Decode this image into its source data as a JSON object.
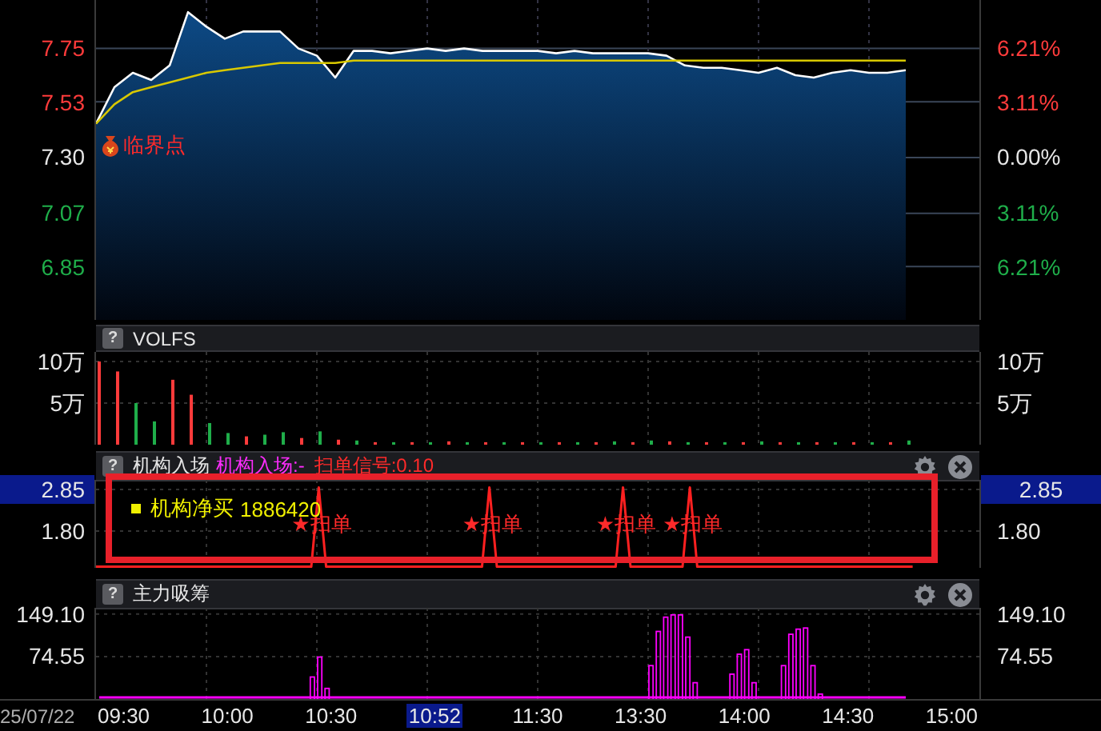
{
  "main_chart": {
    "right_axis": [
      {
        "label": "6.21%",
        "color": "#ff3b3b"
      },
      {
        "label": "3.11%",
        "color": "#ff3b3b"
      },
      {
        "label": "0.00%",
        "color": "#e6e6e6"
      },
      {
        "label": "3.11%",
        "color": "#1fae4a"
      },
      {
        "label": "6.21%",
        "color": "#1fae4a"
      }
    ],
    "marker_label": "临界点",
    "chart_data": {
      "type": "line",
      "categories": [
        null,
        null,
        null,
        null,
        null,
        null,
        null,
        null,
        null,
        null,
        null,
        null,
        null,
        null,
        null,
        null,
        null,
        null,
        null,
        null,
        null,
        null,
        null,
        null,
        null,
        null,
        null,
        null,
        null,
        null,
        null,
        null,
        null,
        null,
        null,
        null,
        null,
        null,
        null,
        null,
        null,
        null,
        null,
        null,
        null,
        null,
        null,
        null,
        null
      ],
      "series": [
        {
          "color": "#ffffff",
          "values": [
            7.44,
            7.59,
            7.65,
            7.62,
            7.68,
            7.9,
            7.84,
            7.79,
            7.82,
            7.82,
            7.82,
            7.75,
            7.72,
            7.63,
            7.74,
            7.74,
            7.73,
            7.74,
            7.75,
            7.74,
            7.75,
            7.74,
            7.74,
            7.74,
            7.74,
            7.73,
            7.74,
            7.73,
            7.73,
            7.73,
            7.73,
            7.72,
            7.68,
            7.67,
            7.67,
            7.66,
            7.65,
            7.67,
            7.64,
            7.63,
            7.65,
            7.66,
            7.65,
            7.65,
            7.66,
            null,
            null,
            null,
            null
          ]
        },
        {
          "color": "#d8c800",
          "values": [
            7.44,
            7.52,
            7.57,
            7.59,
            7.61,
            7.63,
            7.65,
            7.66,
            7.67,
            7.68,
            7.69,
            7.69,
            7.69,
            7.69,
            7.7,
            7.7,
            7.7,
            7.7,
            7.7,
            7.7,
            7.7,
            7.7,
            7.7,
            7.7,
            7.7,
            7.7,
            7.7,
            7.7,
            7.7,
            7.7,
            7.7,
            7.7,
            7.7,
            7.7,
            7.7,
            7.7,
            7.7,
            7.7,
            7.7,
            7.7,
            7.7,
            7.7,
            7.7,
            7.7,
            7.7,
            null,
            null,
            null,
            null
          ]
        }
      ],
      "grid": true,
      "ylim": [
        6.63,
        7.95
      ],
      "yticks": [
        {
          "value": 7.75,
          "label": "7.75"
        },
        {
          "value": 7.53,
          "label": "7.53"
        },
        {
          "value": 7.3,
          "label": "7.30"
        },
        {
          "value": 7.07,
          "label": "7.07"
        },
        {
          "value": 6.85,
          "label": "6.85"
        }
      ]
    }
  },
  "volume_panel": {
    "help_label": "?",
    "controls": false,
    "right_axis": [
      "10万",
      "5万"
    ],
    "chart_data": {
      "type": "bar",
      "title": "VOLFS",
      "categories": [
        null,
        null,
        null,
        null,
        null,
        null,
        null,
        null,
        null,
        null,
        null,
        null,
        null,
        null,
        null,
        null,
        null,
        null,
        null,
        null,
        null,
        null,
        null,
        null,
        null,
        null,
        null,
        null,
        null,
        null,
        null,
        null,
        null,
        null,
        null,
        null,
        null,
        null,
        null,
        null,
        null,
        null,
        null,
        null,
        null,
        null,
        null,
        null
      ],
      "series": [
        {
          "color": "#ff3b3b",
          "values": [
            10,
            8.8,
            null,
            null,
            7.8,
            6,
            null,
            null,
            1,
            null,
            null,
            0.8,
            null,
            0.6,
            null,
            0.3,
            null,
            0.3,
            null,
            0.4,
            null,
            0.3,
            null,
            0.3,
            null,
            0.3,
            null,
            0.3,
            null,
            0.3,
            null,
            0.4,
            null,
            0.3,
            null,
            0.3,
            null,
            0.3,
            null,
            0.3,
            null,
            0.3,
            null,
            0.3,
            null,
            null,
            null,
            null
          ]
        },
        {
          "color": "#1fae4a",
          "values": [
            null,
            null,
            5,
            2.8,
            null,
            null,
            2.6,
            1.4,
            null,
            1.2,
            1.5,
            null,
            1.6,
            null,
            0.5,
            null,
            0.3,
            null,
            0.3,
            null,
            0.3,
            null,
            0.3,
            null,
            0.3,
            null,
            0.3,
            null,
            0.4,
            null,
            0.5,
            null,
            0.3,
            null,
            0.3,
            null,
            0.4,
            null,
            0.3,
            null,
            0.3,
            null,
            0.3,
            null,
            0.5,
            null,
            null,
            null
          ]
        }
      ],
      "grid": true,
      "ylim": [
        0,
        11.15
      ],
      "yticks": [
        {
          "value": 10,
          "label": "10万"
        },
        {
          "value": 5,
          "label": "5万"
        }
      ]
    }
  },
  "signal_panel": {
    "help_label": "?",
    "indicator": "机构入场:-",
    "signal": "扫单信号:0.10",
    "controls": true,
    "left_axis": [
      {
        "selected": true
      },
      {
        "selected": false
      }
    ],
    "right_axis": [
      {
        "label": "2.85",
        "selected": true
      },
      {
        "label": "1.80",
        "selected": false
      }
    ],
    "legend": "机构净买",
    "legend_value": "1886420",
    "sweep_labels": [
      "★扫单",
      "★扫单",
      "★扫单",
      "★扫单"
    ],
    "chart_data": {
      "type": "line",
      "title": "机构入场",
      "categories": [
        null,
        null,
        null,
        null,
        null,
        null,
        null,
        null,
        null,
        null,
        null,
        null,
        null,
        null,
        null,
        null,
        null,
        null,
        null,
        null,
        null,
        null,
        null,
        null,
        null,
        null,
        null,
        null,
        null,
        null,
        null,
        null,
        null,
        null,
        null,
        null,
        null,
        null,
        null,
        null,
        null,
        null,
        null,
        null,
        null,
        null,
        null,
        null,
        null,
        null,
        null,
        null,
        null,
        null,
        null,
        null,
        null,
        null,
        null,
        null,
        null,
        null,
        null,
        null,
        null,
        null,
        null,
        null,
        null,
        null,
        null,
        null,
        null,
        null,
        null,
        null,
        null,
        null,
        null,
        null,
        null,
        null,
        null,
        null,
        null,
        null,
        null,
        null,
        null,
        null,
        null,
        null,
        null,
        null,
        null,
        null,
        null,
        null,
        null,
        null,
        null,
        null,
        null,
        null,
        null,
        null,
        null,
        null,
        null,
        null,
        null,
        null,
        null,
        null,
        null,
        null,
        null,
        null,
        null,
        null
      ],
      "series": [
        {
          "color": "#ff2020",
          "values": [
            0.9,
            0.9,
            0.9,
            0.9,
            0.9,
            0.9,
            0.9,
            0.9,
            0.9,
            0.9,
            0.9,
            0.9,
            0.9,
            0.9,
            0.9,
            0.9,
            0.9,
            0.9,
            0.9,
            0.9,
            0.9,
            0.9,
            0.9,
            0.9,
            0.9,
            0.9,
            0.9,
            0.9,
            0.9,
            0.9,
            2.9,
            0.9,
            0.9,
            0.9,
            0.9,
            0.9,
            0.9,
            0.9,
            0.9,
            0.9,
            0.9,
            0.9,
            0.9,
            0.9,
            0.9,
            0.9,
            0.9,
            0.9,
            0.9,
            0.9,
            0.9,
            0.9,
            0.9,
            2.9,
            0.9,
            0.9,
            0.9,
            0.9,
            0.9,
            0.9,
            0.9,
            0.9,
            0.9,
            0.9,
            0.9,
            0.9,
            0.9,
            0.9,
            0.9,
            0.9,
            0.9,
            2.9,
            0.9,
            0.9,
            0.9,
            0.9,
            0.9,
            0.9,
            0.9,
            0.9,
            2.9,
            0.9,
            0.9,
            0.9,
            0.9,
            0.9,
            0.9,
            0.9,
            0.9,
            0.9,
            0.9,
            0.9,
            0.9,
            0.9,
            0.9,
            0.9,
            0.9,
            0.9,
            0.9,
            0.9,
            0.9,
            0.9,
            0.9,
            0.9,
            0.9,
            0.9,
            0.9,
            0.9,
            0.9,
            0.9,
            0.9,
            null,
            null,
            null,
            null,
            null,
            null,
            null,
            null,
            null
          ]
        }
      ],
      "grid": true,
      "ylim": [
        0.87,
        3.09
      ],
      "yticks": [
        {
          "value": 2.85,
          "label": "2.85"
        },
        {
          "value": 1.8,
          "label": "1.80"
        }
      ]
    }
  },
  "bottom_panel": {
    "help_label": "?",
    "controls": true,
    "right_axis": [
      "149.10",
      "74.55"
    ],
    "chart_data": {
      "type": "bar",
      "title": "主力吸筹",
      "categories": [
        null,
        null,
        null,
        null,
        null,
        null,
        null,
        null,
        null,
        null,
        null,
        null,
        null,
        null,
        null,
        null,
        null,
        null,
        null,
        null,
        null,
        null,
        null,
        null,
        null,
        null,
        null,
        null,
        null,
        null,
        null,
        null,
        null,
        null,
        null,
        null,
        null,
        null,
        null,
        null,
        null,
        null,
        null,
        null,
        null,
        null,
        null,
        null,
        null,
        null,
        null,
        null,
        null,
        null,
        null,
        null,
        null,
        null,
        null,
        null,
        null,
        null,
        null,
        null,
        null,
        null,
        null,
        null,
        null,
        null,
        null,
        null,
        null,
        null,
        null,
        null,
        null,
        null,
        null,
        null,
        null,
        null,
        null,
        null,
        null,
        null,
        null,
        null,
        null,
        null,
        null,
        null,
        null,
        null,
        null,
        null,
        null,
        null,
        null,
        null,
        null,
        null,
        null,
        null,
        null,
        null,
        null,
        null,
        null,
        null,
        null,
        null,
        null,
        null,
        null,
        null,
        null,
        null,
        null,
        null
      ],
      "series": [
        {
          "color": "#ff00ff",
          "values": [
            0,
            0,
            0,
            0,
            0,
            0,
            0,
            0,
            0,
            0,
            0,
            0,
            0,
            0,
            0,
            0,
            0,
            0,
            0,
            0,
            0,
            0,
            0,
            0,
            0,
            0,
            0,
            0,
            0,
            40,
            75,
            20,
            0,
            0,
            0,
            0,
            0,
            0,
            0,
            0,
            0,
            0,
            0,
            0,
            0,
            0,
            0,
            0,
            0,
            0,
            0,
            0,
            0,
            0,
            0,
            0,
            0,
            0,
            0,
            0,
            0,
            0,
            0,
            0,
            0,
            0,
            0,
            0,
            0,
            0,
            0,
            0,
            0,
            0,
            0,
            60,
            120,
            145,
            149,
            149,
            110,
            30,
            0,
            0,
            0,
            0,
            45,
            80,
            88,
            30,
            0,
            0,
            0,
            60,
            115,
            124,
            126,
            60,
            10,
            0,
            0,
            0,
            0,
            0,
            0,
            0,
            0,
            0,
            0,
            0,
            0,
            null,
            null,
            null,
            null,
            null,
            null,
            null,
            null,
            null
          ]
        }
      ],
      "grid": true,
      "ylim": [
        0,
        160
      ],
      "yticks": [
        {
          "value": 149.1,
          "label": "149.10"
        },
        {
          "value": 74.55,
          "label": "74.55"
        }
      ]
    }
  },
  "time_axis": {
    "date": "25/07/22",
    "labels": [
      {
        "label": "09:30",
        "selected": false
      },
      {
        "label": "10:00",
        "selected": false
      },
      {
        "label": "10:30",
        "selected": false
      },
      {
        "label": "10:52",
        "selected": true
      },
      {
        "label": "11:30",
        "selected": false
      },
      {
        "label": "13:30",
        "selected": false
      },
      {
        "label": "14:00",
        "selected": false
      },
      {
        "label": "14:30",
        "selected": false
      },
      {
        "label": "15:00",
        "selected": false
      }
    ]
  }
}
